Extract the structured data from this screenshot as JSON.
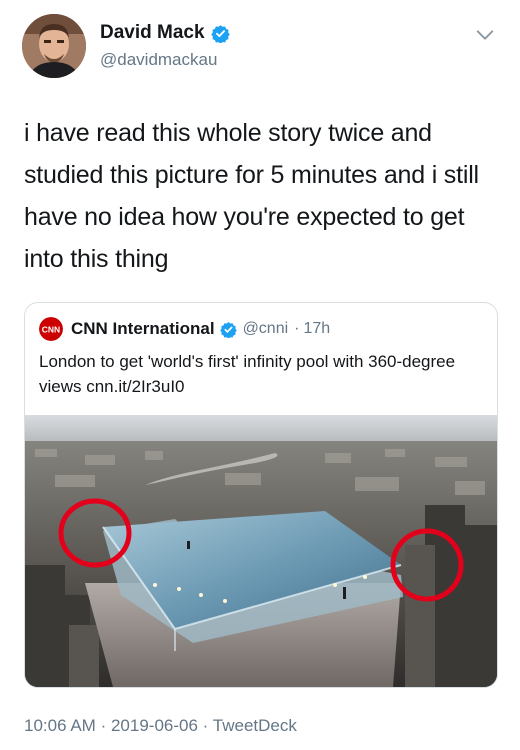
{
  "user": {
    "name": "David Mack",
    "handle": "@davidmackau",
    "avatar_icon": "avatar",
    "verified_icon": "verified-badge-icon"
  },
  "tweet": {
    "text": "i have read this whole story twice and studied this picture for 5 minutes and i still have no idea how you're expected to get into this thing"
  },
  "quoted": {
    "logo_text": "CNN",
    "name": "CNN International",
    "handle": "@cnni",
    "separator": "·",
    "time": "17h",
    "text": "London to get 'world's first' infinity pool with 360-degree views cnn.it/2Ir3uI0"
  },
  "meta": {
    "time": "10:06 AM",
    "date": "2019-06-06",
    "separator": "·",
    "source": "TweetDeck"
  },
  "colors": {
    "verified": "#1da1f2",
    "secondary_text": "#657786",
    "highlight_circle": "#e3001b",
    "cnn_red": "#cc0000"
  }
}
